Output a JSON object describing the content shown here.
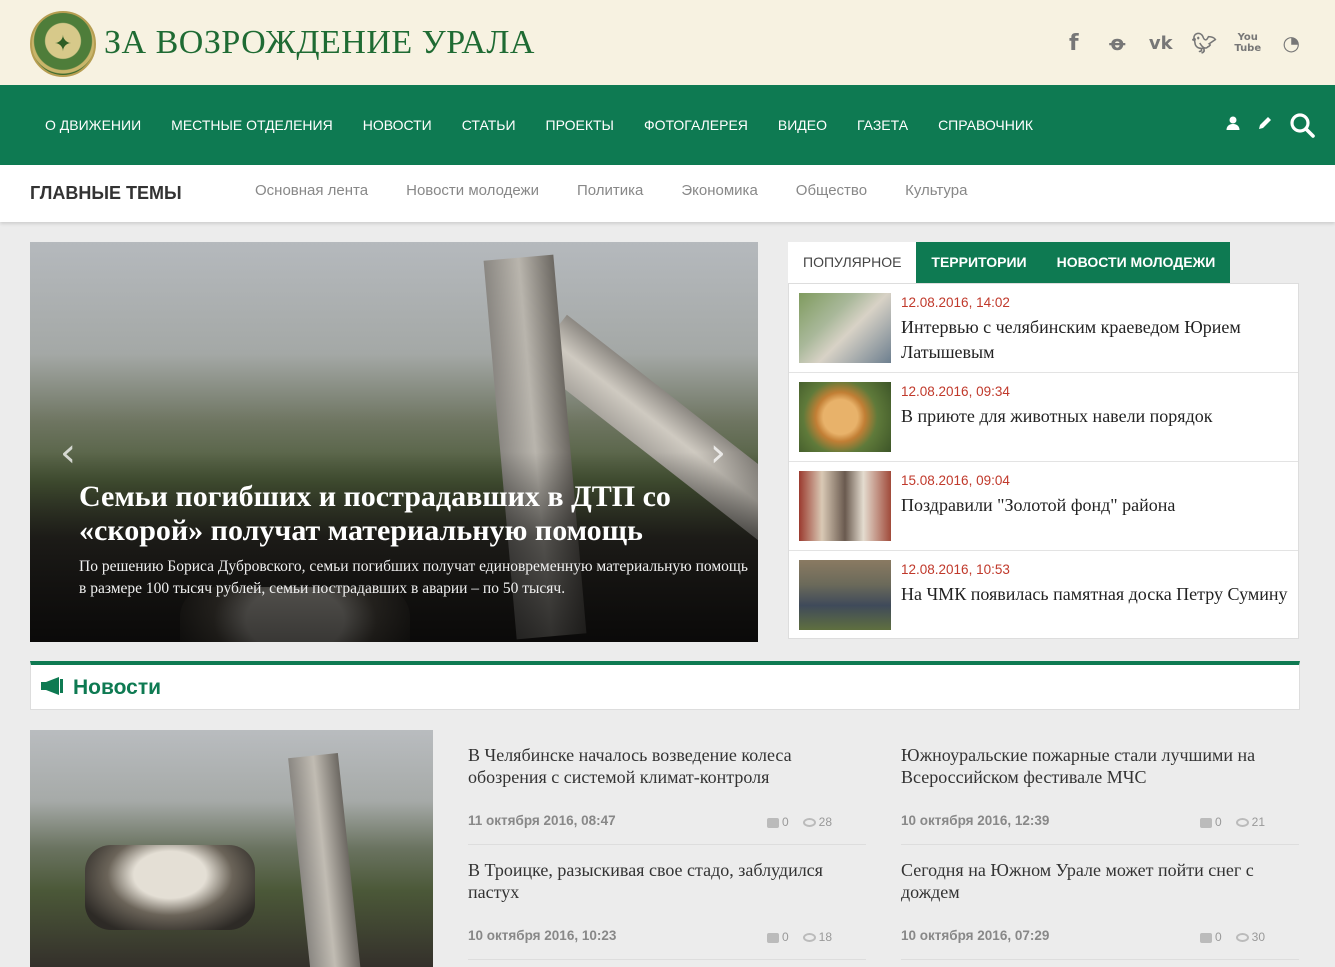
{
  "header": {
    "site_title": "ЗА ВОЗРОЖДЕНИЕ УРАЛА",
    "social_icons": [
      "facebook-icon",
      "odnoklassniki-icon",
      "vk-icon",
      "twitter-icon",
      "youtube-icon",
      "rss-icon"
    ],
    "social_glyphs": [
      "f",
      "ок",
      "vk",
      "t",
      "You Tube",
      "rss"
    ]
  },
  "nav": {
    "items": [
      "О ДВИЖЕНИИ",
      "МЕСТНЫЕ ОТДЕЛЕНИЯ",
      "НОВОСТИ",
      "СТАТЬИ",
      "ПРОЕКТЫ",
      "ФОТОГАЛЕРЕЯ",
      "ВИДЕО",
      "ГАЗЕТА",
      "СПРАВОЧНИК"
    ],
    "tools": [
      "user-icon",
      "pencil-icon",
      "search-icon"
    ]
  },
  "topics": {
    "title": "ГЛАВНЫЕ ТЕМЫ",
    "items": [
      "Основная лента",
      "Новости молодежи",
      "Политика",
      "Экономика",
      "Общество",
      "Культура"
    ]
  },
  "slider": {
    "headline": "Семьи погибших и пострадавших в ДТП со «скорой» получат материальную помощь",
    "lead": "По решению Бориса Дубровского, семьи погибших получат единовременную материальную помощь в размере 100 тысяч рублей, семьи пострадавших в аварии – по 50 тысяч."
  },
  "tabs": {
    "items": [
      "ПОПУЛЯРНОЕ",
      "ТЕРРИТОРИИ",
      "НОВОСТИ МОЛОДЕЖИ"
    ],
    "popular": [
      {
        "date": "12.08.2016, 14:02",
        "title": "Интервью с челябинским краеведом Юрием Латышевым"
      },
      {
        "date": "12.08.2016, 09:34",
        "title": "В приюте для животных навели порядок"
      },
      {
        "date": "15.08.2016, 09:04",
        "title": "Поздравили \"Золотой фонд\" района"
      },
      {
        "date": "12.08.2016, 10:53",
        "title": "На ЧМК появилась памятная доска Петру Сумину"
      }
    ]
  },
  "news": {
    "title": "Новости",
    "items": [
      {
        "title": "В Челябинске началось возведение колеса обозрения с системой климат-контроля",
        "date": "11 октября 2016, 08:47",
        "comments": "0",
        "views": "28"
      },
      {
        "title": "Южноуральские пожарные стали лучшими на Всероссийском фестивале МЧС",
        "date": "10 октября 2016, 12:39",
        "comments": "0",
        "views": "21"
      },
      {
        "title": "В Троицке, разыскивая свое стадо, заблудился пастух",
        "date": "10 октября 2016, 10:23",
        "comments": "0",
        "views": "18"
      },
      {
        "title": "Сегодня на Южном Урале может пойти снег с дождем",
        "date": "10 октября 2016, 07:29",
        "comments": "0",
        "views": "30"
      }
    ]
  },
  "colors": {
    "brand_green": "#0e7a52",
    "header_bg": "#f7f2e1",
    "date_red": "#c0392b"
  }
}
